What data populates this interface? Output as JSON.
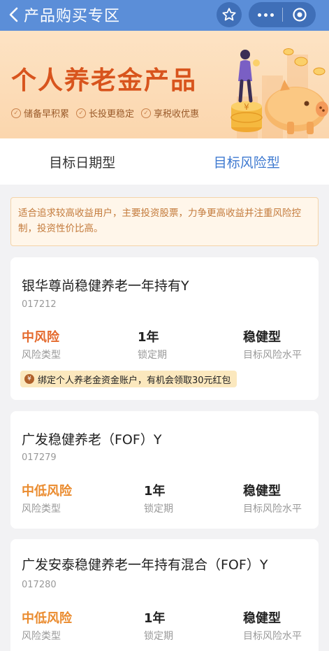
{
  "nav": {
    "back_icon": "chevron-left-icon",
    "title": "产品购买专区",
    "star_icon": "star-icon",
    "more_icon": "more-dots-icon",
    "close_icon": "target-close-icon"
  },
  "banner": {
    "title": "个人养老金产品",
    "tags": [
      {
        "icon": "check-circle-icon",
        "label": "储备早积累"
      },
      {
        "icon": "check-circle-icon",
        "label": "长投更稳定"
      },
      {
        "icon": "check-circle-icon",
        "label": "享税收优惠"
      }
    ]
  },
  "tabs": [
    {
      "label": "目标日期型",
      "active": false
    },
    {
      "label": "目标风险型",
      "active": true
    }
  ],
  "notice": "适合追求较高收益用户，主要投资股票，力争更高收益并注重风险控制，投资性价比高。",
  "products": [
    {
      "name": "银华尊尚稳健养老一年持有Y",
      "code": "017212",
      "risk": "中风险",
      "risk_label": "风险类型",
      "lock": "1年",
      "lock_label": "锁定期",
      "target": "稳健型",
      "target_label": "目标风险水平",
      "promo": "绑定个人养老金资金账户，有机会领取30元红包"
    },
    {
      "name": "广发稳健养老（FOF）Y",
      "code": "017279",
      "risk": "中低风险",
      "risk_label": "风险类型",
      "lock": "1年",
      "lock_label": "锁定期",
      "target": "稳健型",
      "target_label": "目标风险水平"
    },
    {
      "name": "广发安泰稳健养老一年持有混合（FOF）Y",
      "code": "017280",
      "risk": "中低风险",
      "risk_label": "风险类型",
      "lock": "1年",
      "lock_label": "锁定期",
      "target": "稳健型",
      "target_label": "目标风险水平"
    }
  ],
  "colors": {
    "nav_bg": "#5b8ed8",
    "tab_active": "#3e79d0",
    "risk_mid": "#e4692c",
    "risk_low_mid": "#ea8b2e"
  }
}
